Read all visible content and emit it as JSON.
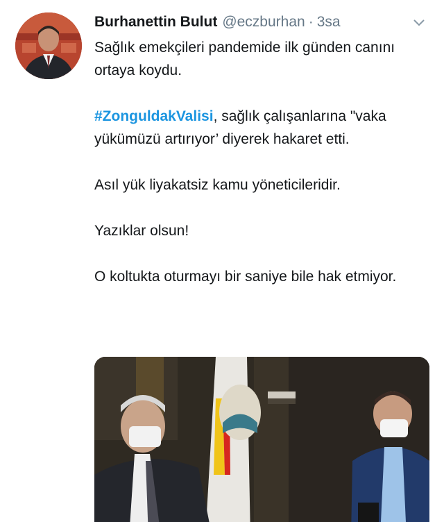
{
  "tweet": {
    "author_name": "Burhanettin Bulut",
    "author_handle": "@eczburhan",
    "separator": "·",
    "timestamp": "3sa",
    "text": {
      "line1": "Sağlık emekçileri pandemide ilk günden canını ortaya koydu.",
      "hashtag": "#ZonguldakValisi",
      "line2_rest": ", sağlık çalışanlarına \"vaka yükümüzü artırıyor’ diyerek hakaret etti.",
      "line3": "Asıl yük liyakatsiz kamu yöneticileridir.",
      "line4": "Yazıklar olsun!",
      "line5": "O koltukta oturmayı bir saniye bile hak etmiyor."
    },
    "icons": {
      "avatar": "profile-photo",
      "menu": "chevron-down-icon",
      "media": "video-thumbnail"
    },
    "colors": {
      "hashtag": "#1b95e0",
      "secondary_text": "#657786",
      "primary_text": "#14171a"
    }
  }
}
